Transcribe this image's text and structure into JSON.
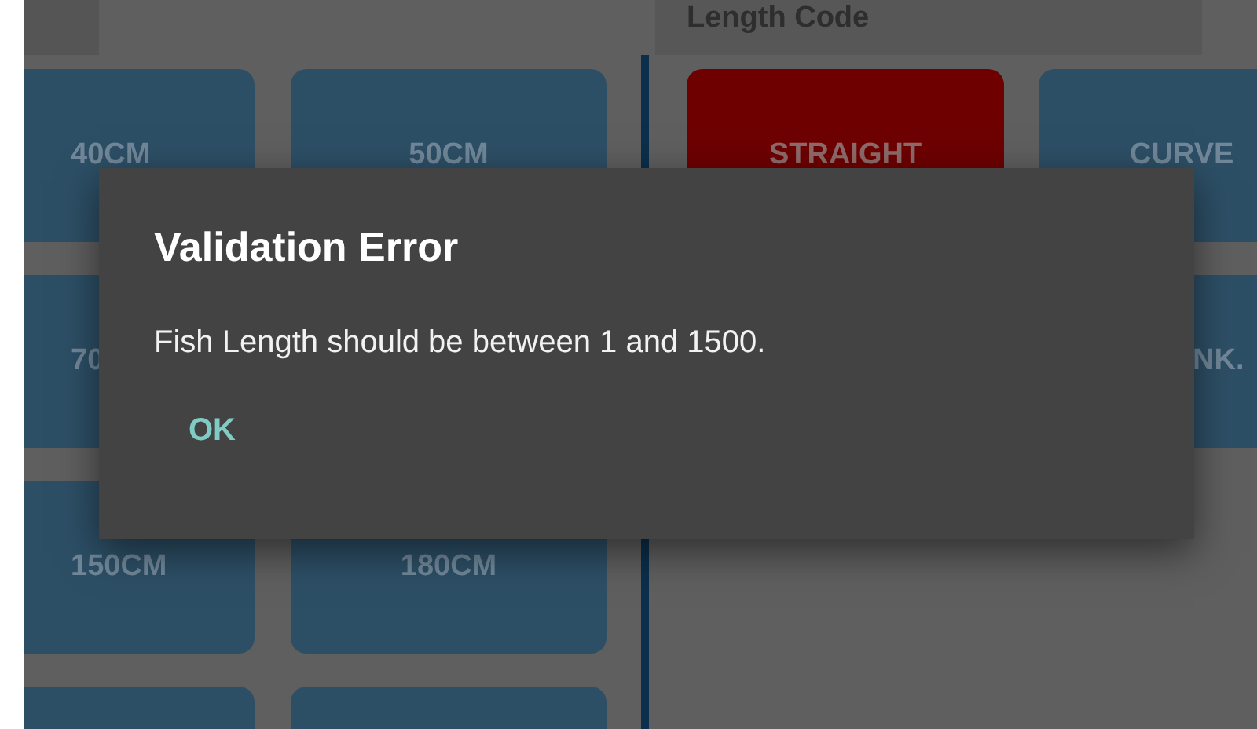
{
  "length_buttons": [
    "40CM",
    "50CM",
    "70",
    "150CM",
    "180CM"
  ],
  "length_code": {
    "title": "Length Code",
    "options": [
      {
        "label": "STRAIGHT",
        "selected": true
      },
      {
        "label": "CURVE",
        "selected": false
      },
      {
        "label": "NK.",
        "selected": false
      }
    ]
  },
  "dialog": {
    "title": "Validation Error",
    "message": "Fish Length should be between 1 and 1500.",
    "buttons": [
      "OK"
    ]
  }
}
